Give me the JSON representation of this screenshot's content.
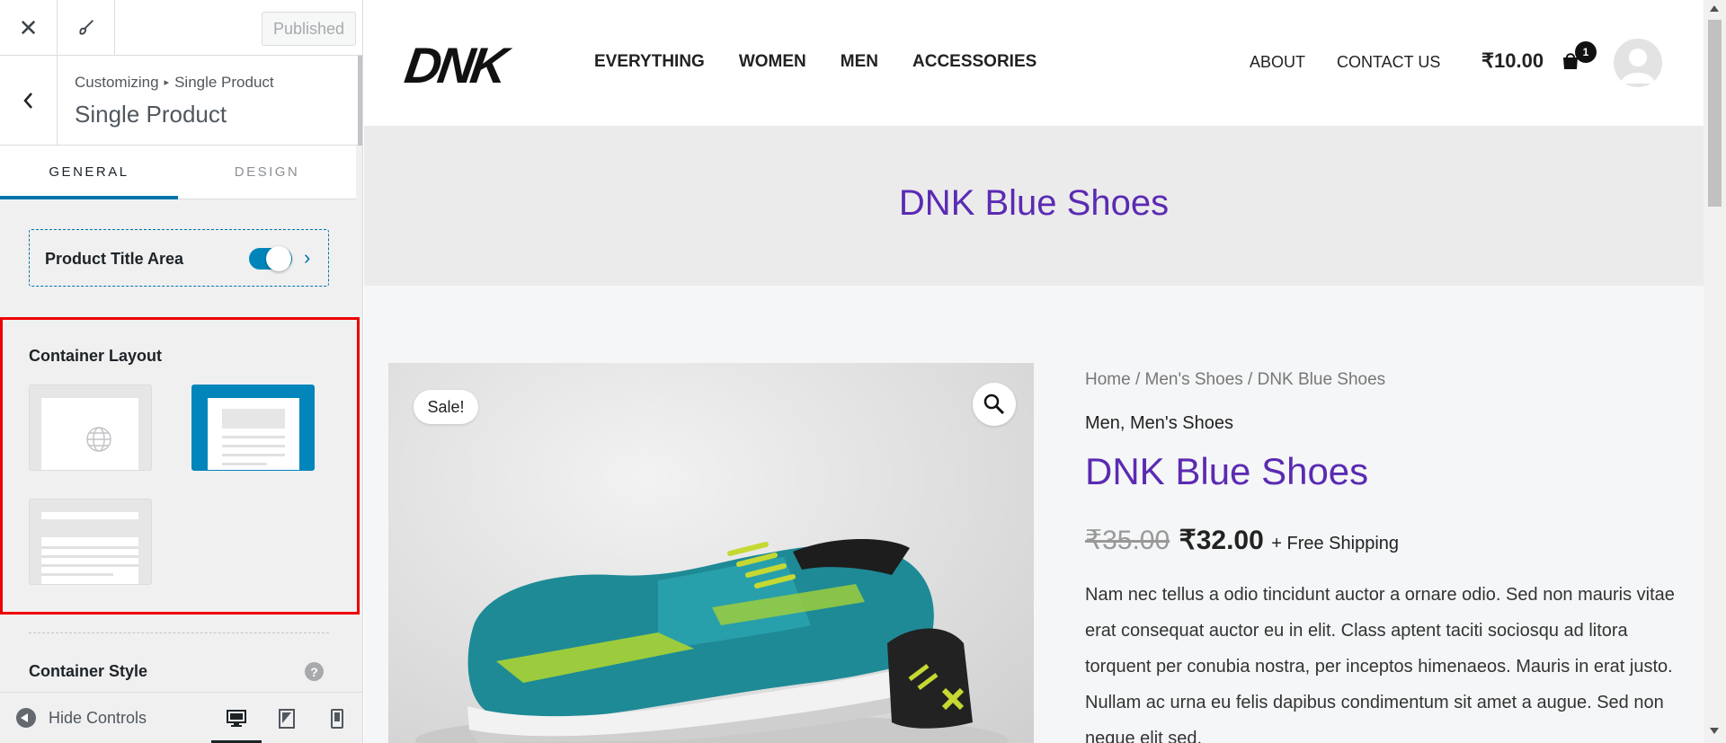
{
  "customizer": {
    "close_icon": "close-icon",
    "brush_icon": "brush-icon",
    "publish_label": "Published",
    "breadcrumb_root": "Customizing",
    "breadcrumb_separator": "▸",
    "breadcrumb_current": "Single Product",
    "section_title": "Single Product",
    "tabs": [
      {
        "label": "GENERAL",
        "active": true
      },
      {
        "label": "DESIGN",
        "active": false
      }
    ],
    "product_title_area": {
      "label": "Product Title Area",
      "enabled": true
    },
    "container_layout": {
      "label": "Container Layout",
      "options": [
        {
          "name": "default-globe",
          "selected": false
        },
        {
          "name": "boxed",
          "selected": true
        },
        {
          "name": "full-width",
          "selected": false
        }
      ]
    },
    "container_style": {
      "label": "Container Style",
      "help": "?"
    },
    "footer": {
      "hide_controls_label": "Hide Controls",
      "devices": [
        {
          "name": "desktop",
          "active": true
        },
        {
          "name": "tablet",
          "active": false
        },
        {
          "name": "mobile",
          "active": false
        }
      ]
    },
    "accent_color": "#0073aa"
  },
  "site": {
    "logo_text": "DNK",
    "nav": [
      "EVERYTHING",
      "WOMEN",
      "MEN",
      "ACCESSORIES"
    ],
    "nav_right": [
      "ABOUT",
      "CONTACT US"
    ],
    "cart_total": "₹10.00",
    "cart_count": "1",
    "title_band": "DNK Blue Shoes",
    "sale_badge": "Sale!",
    "breadcrumb": "Home / Men's Shoes / DNK Blue Shoes",
    "categories": "Men, Men's Shoes",
    "product_title": "DNK Blue Shoes",
    "old_price": "₹35.00",
    "new_price": "₹32.00",
    "shipping": "+ Free Shipping",
    "description": "Nam nec tellus a odio tincidunt auctor a ornare odio. Sed non mauris vitae erat consequat auctor eu in elit. Class aptent taciti sociosqu ad litora torquent per conubia nostra, per inceptos himenaeos. Mauris in erat justo. Nullam ac urna eu felis dapibus condimentum sit amet a augue. Sed non neque elit sed.",
    "title_color": "#5b2bb2"
  }
}
